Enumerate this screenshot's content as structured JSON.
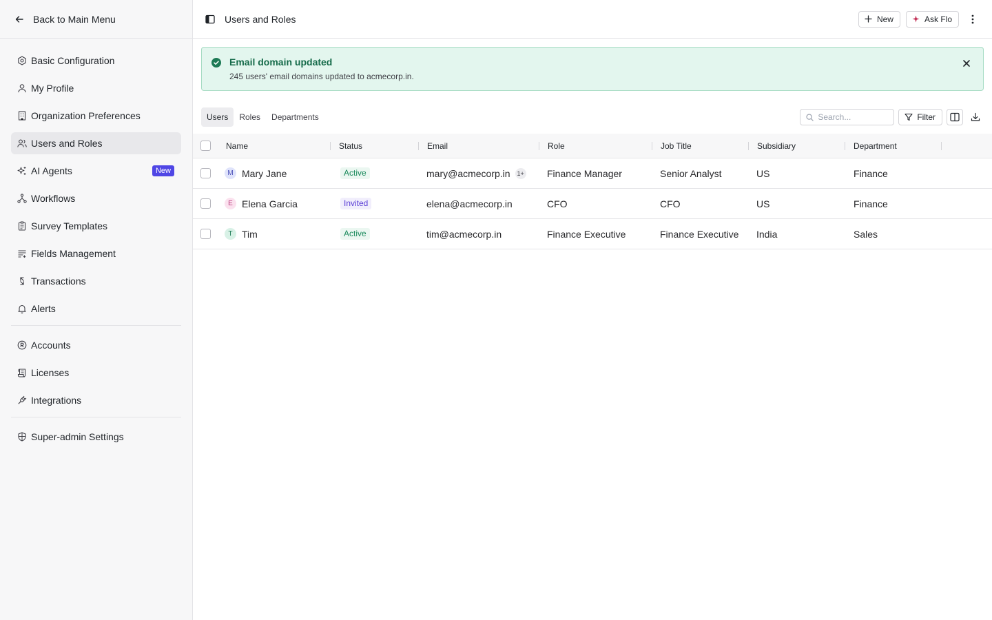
{
  "sidebar": {
    "back_label": "Back to Main Menu",
    "groups": [
      [
        {
          "label": "Basic Configuration",
          "icon": "settings-icon"
        },
        {
          "label": "My Profile",
          "icon": "user-icon"
        },
        {
          "label": "Organization Preferences",
          "icon": "building-icon"
        },
        {
          "label": "Users and Roles",
          "icon": "users-icon",
          "active": true
        },
        {
          "label": "AI Agents",
          "icon": "sparkles-icon",
          "badge": "New"
        },
        {
          "label": "Workflows",
          "icon": "workflow-icon"
        },
        {
          "label": "Survey Templates",
          "icon": "clipboard-icon"
        },
        {
          "label": "Fields Management",
          "icon": "list-filter-icon"
        },
        {
          "label": "Transactions",
          "icon": "arrows-icon"
        },
        {
          "label": "Alerts",
          "icon": "bell-icon"
        }
      ],
      [
        {
          "label": "Accounts",
          "icon": "registered-icon"
        },
        {
          "label": "Licenses",
          "icon": "scroll-icon"
        },
        {
          "label": "Integrations",
          "icon": "plug-icon"
        }
      ],
      [
        {
          "label": "Super-admin Settings",
          "icon": "shield-icon"
        }
      ]
    ]
  },
  "header": {
    "title": "Users and Roles",
    "new_label": "New",
    "ask_label": "Ask Flo"
  },
  "toast": {
    "title": "Email domain updated",
    "message": "245 users' email domains updated to acmecorp.in."
  },
  "tabs": [
    "Users",
    "Roles",
    "Departments"
  ],
  "active_tab": 0,
  "search": {
    "placeholder": "Search..."
  },
  "filter_label": "Filter",
  "table": {
    "columns": [
      "Name",
      "Status",
      "Email",
      "Role",
      "Job Title",
      "Subsidiary",
      "Department"
    ],
    "rows": [
      {
        "initial": "M",
        "name": "Mary Jane",
        "status": "Active",
        "email": "mary@acmecorp.in",
        "extra": "1+",
        "role": "Finance Manager",
        "job": "Senior Analyst",
        "sub": "US",
        "dept": "Finance"
      },
      {
        "initial": "E",
        "name": "Elena Garcia",
        "status": "Invited",
        "email": "elena@acmecorp.in",
        "extra": "",
        "role": "CFO",
        "job": "CFO",
        "sub": "US",
        "dept": "Finance"
      },
      {
        "initial": "T",
        "name": "Tim",
        "status": "Active",
        "email": "tim@acmecorp.in",
        "extra": "",
        "role": "Finance Executive",
        "job": "Finance Executive",
        "sub": "India",
        "dept": "Sales"
      }
    ]
  },
  "colors": {
    "accent": "#4f46e5",
    "ask_flo_spark": "#c0264e",
    "success_bg": "#e3f6ee",
    "success_text": "#166b4a",
    "avatar_m": "#dfe3fb",
    "avatar_e": "#fbe1ee",
    "avatar_t": "#d8f1e6"
  }
}
